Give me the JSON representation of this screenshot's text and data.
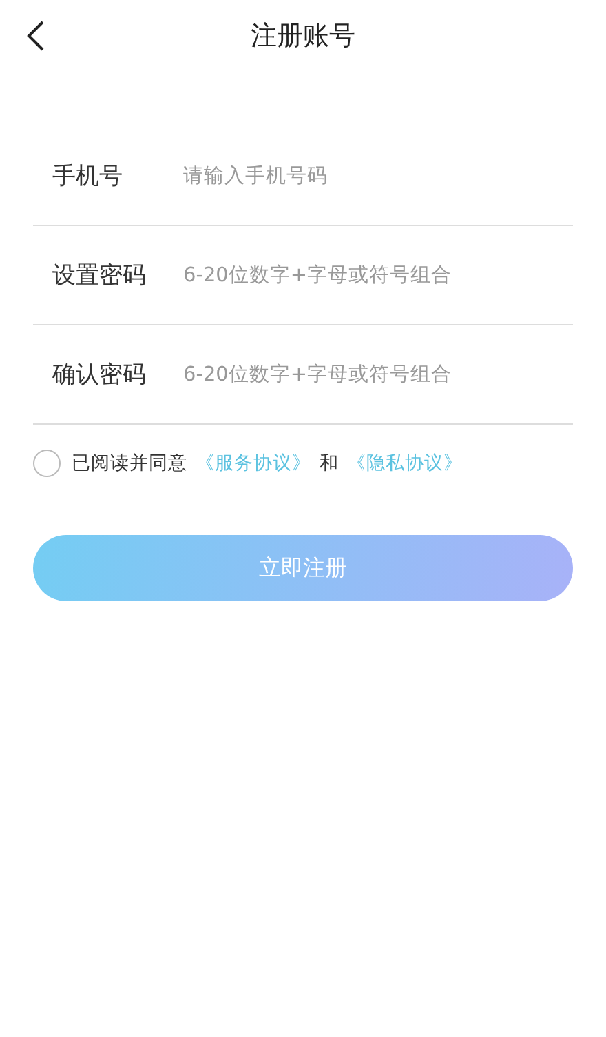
{
  "header": {
    "title": "注册账号"
  },
  "fields": [
    {
      "label": "手机号",
      "placeholder": "请输入手机号码"
    },
    {
      "label": "设置密码",
      "placeholder": "6-20位数字+字母或符号组合"
    },
    {
      "label": "确认密码",
      "placeholder": "6-20位数字+字母或符号组合"
    }
  ],
  "agreement": {
    "checked": false,
    "prefix": "已阅读并同意",
    "link_1": "《服务协议》",
    "joiner": "和",
    "link_2": "《隐私协议》"
  },
  "submit_button": "立即注册"
}
